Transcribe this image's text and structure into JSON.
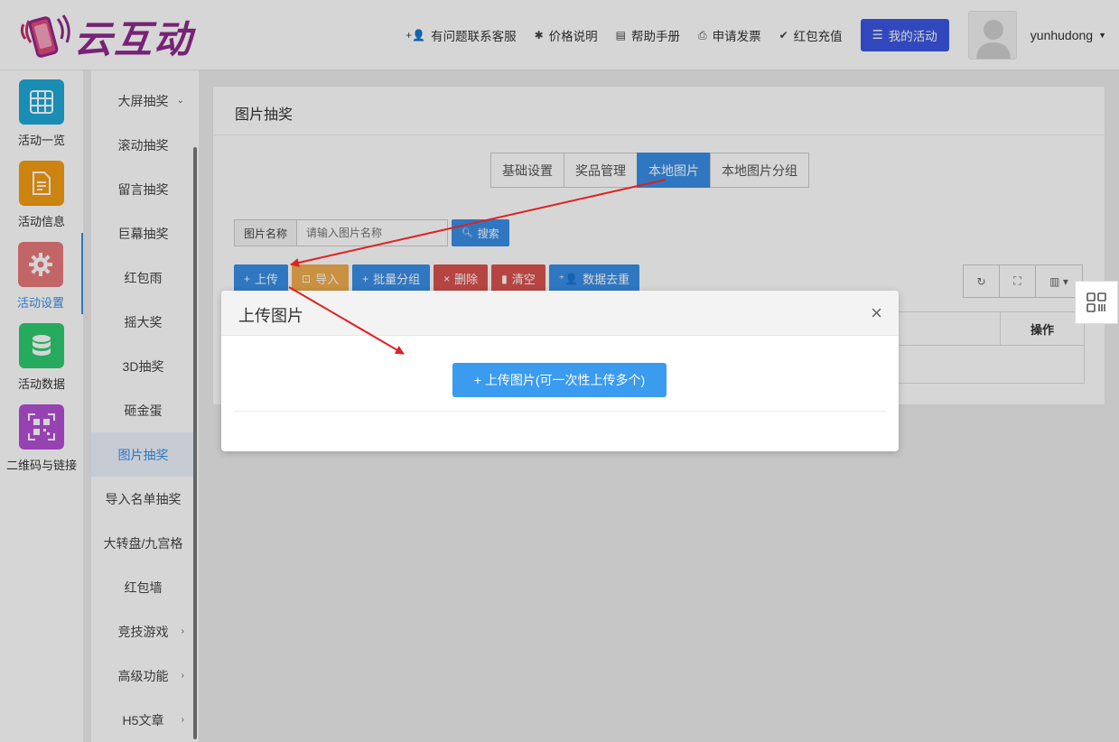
{
  "header": {
    "logo_text": "云互动",
    "nav": [
      {
        "icon": "user-plus-icon",
        "glyph": "⁺👤",
        "label": "有问题联系客服"
      },
      {
        "icon": "gear-icon",
        "glyph": "✱",
        "label": "价格说明"
      },
      {
        "icon": "book-icon",
        "glyph": "▤",
        "label": "帮助手册"
      },
      {
        "icon": "printer-icon",
        "glyph": "⎙",
        "label": "申请发票"
      },
      {
        "icon": "shield-check-icon",
        "glyph": "✔",
        "label": "红包充值"
      }
    ],
    "my_activity": "我的活动",
    "username": "yunhudong"
  },
  "iconbar": [
    {
      "label": "活动一览",
      "icon": "grid-icon",
      "color": "#1fa8d8"
    },
    {
      "label": "活动信息",
      "icon": "document-icon",
      "color": "#f39c12"
    },
    {
      "label": "活动设置",
      "icon": "gear-icon",
      "color": "#e8797b"
    },
    {
      "label": "活动数据",
      "icon": "database-icon",
      "color": "#2ecc71"
    },
    {
      "label": "二维码与链接",
      "icon": "qrcode-icon",
      "color": "#b44fd6"
    }
  ],
  "submenu": [
    {
      "label": "大屏抽奖",
      "chev": "⌄"
    },
    {
      "label": "滚动抽奖",
      "chev": ""
    },
    {
      "label": "留言抽奖",
      "chev": ""
    },
    {
      "label": "巨幕抽奖",
      "chev": ""
    },
    {
      "label": "红包雨",
      "chev": ""
    },
    {
      "label": "摇大奖",
      "chev": ""
    },
    {
      "label": "3D抽奖",
      "chev": ""
    },
    {
      "label": "砸金蛋",
      "chev": ""
    },
    {
      "label": "图片抽奖",
      "chev": ""
    },
    {
      "label": "导入名单抽奖",
      "chev": ""
    },
    {
      "label": "大转盘/九宫格",
      "chev": ""
    },
    {
      "label": "红包墙",
      "chev": ""
    },
    {
      "label": "竞技游戏",
      "chev": "›"
    },
    {
      "label": "高级功能",
      "chev": "›"
    },
    {
      "label": "H5文章",
      "chev": "›"
    }
  ],
  "panel": {
    "title": "图片抽奖",
    "tabs": [
      "基础设置",
      "奖品管理",
      "本地图片",
      "本地图片分组"
    ],
    "search_label": "图片名称",
    "search_placeholder": "请输入图片名称",
    "search_btn": "搜索",
    "actions": [
      {
        "label": "上传",
        "glyph": "+",
        "color": "#3a8ee6"
      },
      {
        "label": "导入",
        "glyph": "⊡",
        "color": "#f0ad4e"
      },
      {
        "label": "批量分组",
        "glyph": "+",
        "color": "#3a8ee6"
      },
      {
        "label": "删除",
        "glyph": "×",
        "color": "#d9534f"
      },
      {
        "label": "清空",
        "glyph": "▮",
        "color": "#d9534f"
      },
      {
        "label": "数据去重",
        "glyph": "⁺👤",
        "color": "#3a8ee6"
      }
    ],
    "column_op": "操作"
  },
  "modal": {
    "title": "上传图片",
    "upload_btn": "+ 上传图片(可一次性上传多个)"
  }
}
